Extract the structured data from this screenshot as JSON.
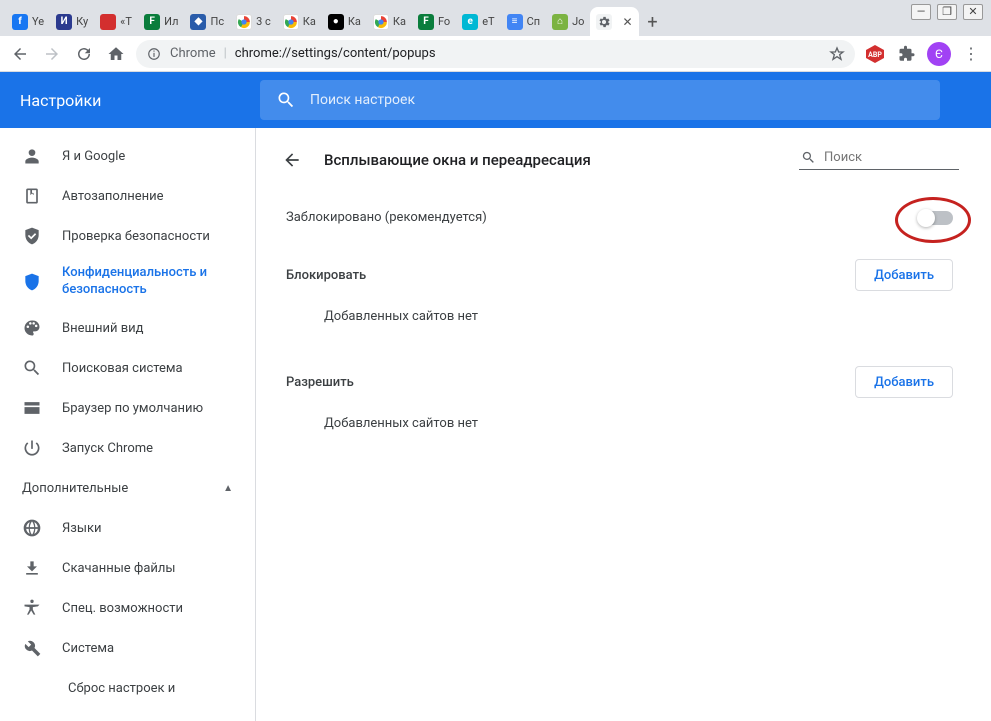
{
  "window_controls": {
    "min": "—",
    "max": "❐",
    "close": "✕"
  },
  "tabs": [
    {
      "label": "Ye",
      "color": "#1877f2",
      "glyph": "f"
    },
    {
      "label": "Ку",
      "color": "#2b3a8f",
      "glyph": "И"
    },
    {
      "label": "«Т",
      "color": "#d32f2f",
      "glyph": " "
    },
    {
      "label": "Ил",
      "color": "#0a7d3c",
      "glyph": "F"
    },
    {
      "label": "Пс",
      "color": "#2a5caa",
      "glyph": "◆"
    },
    {
      "label": "3 с",
      "color": "#ffffff",
      "glyph": "G"
    },
    {
      "label": "Ка",
      "color": "#ffffff",
      "glyph": "G"
    },
    {
      "label": "Ка",
      "color": "#000000",
      "glyph": "●"
    },
    {
      "label": "Ка",
      "color": "#ffffff",
      "glyph": "G"
    },
    {
      "label": "Fo",
      "color": "#0a7d3c",
      "glyph": "F"
    },
    {
      "label": "eT",
      "color": "#00b8d4",
      "glyph": "e"
    },
    {
      "label": "Сп",
      "color": "#4285f4",
      "glyph": "≡"
    },
    {
      "label": "Jo",
      "color": "#7cb342",
      "glyph": "⌂"
    }
  ],
  "active_tab": {
    "label": "",
    "close": "✕"
  },
  "newtab": "+",
  "omnibox": {
    "chrome_label": "Chrome",
    "separator": "|",
    "url": "chrome://settings/content/popups"
  },
  "avatar_letter": "Є",
  "settings_title": "Настройки",
  "header_search_placeholder": "Поиск настроек",
  "sidebar": {
    "items": [
      {
        "icon": "person",
        "label": "Я и Google"
      },
      {
        "icon": "autofill",
        "label": "Автозаполнение"
      },
      {
        "icon": "shield-check",
        "label": "Проверка безопасности"
      },
      {
        "icon": "shield",
        "label": "Конфиденциальность и безопасность"
      },
      {
        "icon": "palette",
        "label": "Внешний вид"
      },
      {
        "icon": "search",
        "label": "Поисковая система"
      },
      {
        "icon": "browser",
        "label": "Браузер по умолчанию"
      },
      {
        "icon": "power",
        "label": "Запуск Chrome"
      }
    ],
    "advanced_label": "Дополнительные",
    "advanced_items": [
      {
        "icon": "globe",
        "label": "Языки"
      },
      {
        "icon": "download",
        "label": "Скачанные файлы"
      },
      {
        "icon": "accessibility",
        "label": "Спец. возможности"
      },
      {
        "icon": "wrench",
        "label": "Система"
      }
    ],
    "reset_label": "Сброс настроек и"
  },
  "page": {
    "heading": "Всплывающие окна и переадресация",
    "local_search_placeholder": "Поиск",
    "blocked_label": "Заблокировано (рекомендуется)",
    "sections": [
      {
        "title": "Блокировать",
        "add": "Добавить",
        "empty": "Добавленных сайтов нет"
      },
      {
        "title": "Разрешить",
        "add": "Добавить",
        "empty": "Добавленных сайтов нет"
      }
    ]
  }
}
